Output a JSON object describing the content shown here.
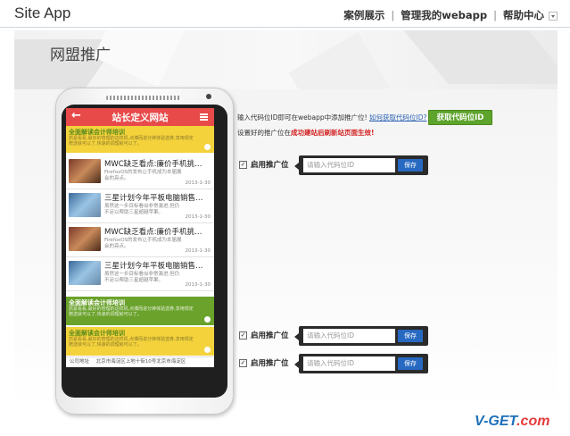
{
  "header": {
    "logo": "Site App",
    "nav": [
      {
        "label": "案例展示"
      },
      {
        "label": "管理我的webapp"
      },
      {
        "label": "帮助中心"
      }
    ]
  },
  "banner": {
    "title": "网盟推广"
  },
  "phone_app": {
    "title": "站长定义网站",
    "promo_title": "全面解读会计师培训",
    "promo_desc": "抓紧看看,最好的管理的这样机,点博而进分钟体验选券,享用规定赠送就可以了,快速的调理就可以了。",
    "news": [
      {
        "title": "MWC缺乏看点:廉价手机挑…",
        "desc": "FirefoxOS的发布让手机成为本届展会的亮点。",
        "date": "2013-1-30"
      },
      {
        "title": "三星计划今年平板电脑销售…",
        "desc": "虽然这一步目标看似非常激进,但仍不足以帮助三星超越苹果。",
        "date": "2013-1-30"
      },
      {
        "title": "MWC缺乏看点:廉价手机挑…",
        "desc": "FirefoxOS的发布让手机成为本届展会的亮点。",
        "date": "2013-1-30"
      },
      {
        "title": "三星计划今年平板电脑销售…",
        "desc": "虽然这一步目标看似非常激进,但仍不足以帮助三星超越苹果。",
        "date": "2013-1-30"
      }
    ],
    "footer_label": "公司地址",
    "footer_address": "北京市海淀区上地十街10号北京市海淀区"
  },
  "info": {
    "line1_text": "输入代码位ID即可在webapp中添加推广位!",
    "line1_link": "如何获取代码位ID?",
    "line2_prefix": "设置好的推广位在",
    "line2_red": "成功建站后刷新站页面生效!",
    "get_id_button": "获取代码位ID"
  },
  "slots": [
    {
      "checkbox_label": "启用推广位",
      "placeholder": "请输入代码位ID",
      "save": "保存",
      "checked": true
    },
    {
      "checkbox_label": "启用推广位",
      "placeholder": "请输入代码位ID",
      "save": "保存",
      "checked": true
    },
    {
      "checkbox_label": "启用推广位",
      "placeholder": "请输入代码位ID",
      "save": "保存",
      "checked": true
    }
  ],
  "watermark": {
    "text": "V-GET",
    "suffix": ".com"
  },
  "colors": {
    "app_header": "#e84a4a",
    "promo_yellow": "#f4d23c",
    "promo_green": "#6aa22b",
    "get_id_button": "#5ea42c",
    "save_button": "#2769c1",
    "link_blue": "#2a61b4",
    "warning_red": "#d21f1f"
  }
}
